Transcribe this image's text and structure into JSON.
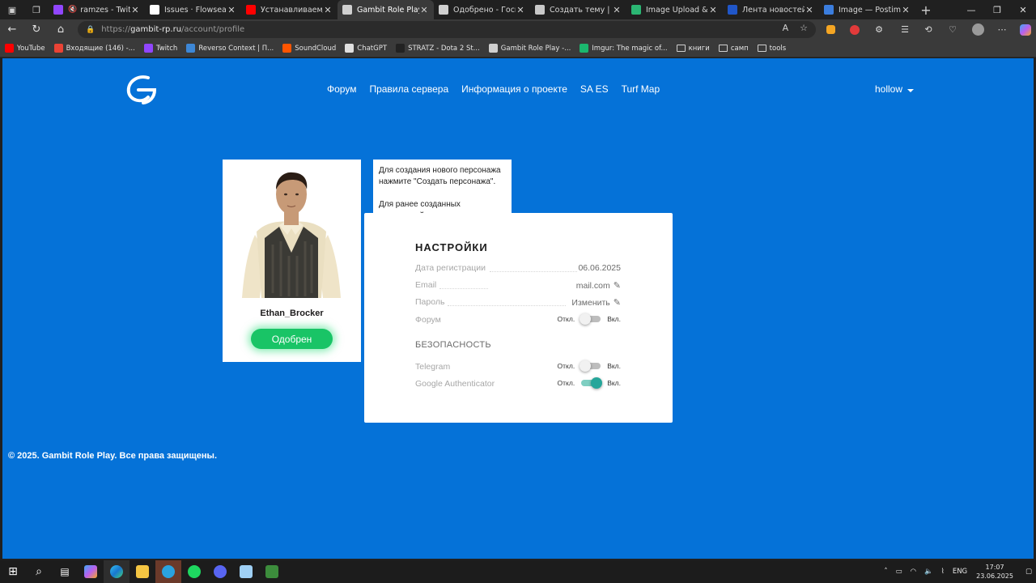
{
  "browser": {
    "tabs": [
      {
        "title": "ramzes - Twitch",
        "color": "#9146ff",
        "muted": true
      },
      {
        "title": "Issues · Flowseal/zapr",
        "color": "#ffffff"
      },
      {
        "title": "Устанавливаем/чини",
        "color": "#ff0000"
      },
      {
        "title": "Gambit Role Play - Пр",
        "color": "#d0d0d0",
        "active": true
      },
      {
        "title": "Одобрено - Госпита",
        "color": "#d0d0d0"
      },
      {
        "title": "Создать тему | San A",
        "color": "#c8c8c8"
      },
      {
        "title": "Image Upload & Mem",
        "color": "#2bb673"
      },
      {
        "title": "Лента новостей",
        "color": "#2056c8"
      },
      {
        "title": "Image — Postimages",
        "color": "#3b7ddd"
      }
    ],
    "url_prefix": "https://",
    "url_host": "gambit-rp.ru",
    "url_path": "/account/profile",
    "bookmarks": [
      {
        "label": "YouTube",
        "color": "#ff0000"
      },
      {
        "label": "Входящие (146) -...",
        "color": "#ea4335"
      },
      {
        "label": "Twitch",
        "color": "#9146ff"
      },
      {
        "label": "Reverso Context | П...",
        "color": "#3d87d6"
      },
      {
        "label": "SoundCloud",
        "color": "#ff5500"
      },
      {
        "label": "ChatGPT",
        "color": "#e0e0e0"
      },
      {
        "label": "STRATZ - Dota 2 St...",
        "color": "#222222"
      },
      {
        "label": "Gambit Role Play -...",
        "color": "#d0d0d0"
      },
      {
        "label": "Imgur: The magic of...",
        "color": "#1bb76e"
      },
      {
        "label": "книги",
        "folder": true
      },
      {
        "label": "самп",
        "folder": true
      },
      {
        "label": "tools",
        "folder": true
      }
    ]
  },
  "site": {
    "nav": [
      "Форум",
      "Правила сервера",
      "Информация о проекте",
      "SA ES",
      "Turf Map"
    ],
    "username": "hollow",
    "accent": "#0572d8"
  },
  "character": {
    "name": "Ethan_Brocker",
    "status": "Одобрен",
    "status_color": "#19c466"
  },
  "tooltip": {
    "line1": "Для создания нового персонажа нажмите \"Создать персонажа\".",
    "line2": "Для ранее созданных персонажей"
  },
  "settings": {
    "title": "НАСТРОЙКИ",
    "rows": [
      {
        "label": "Дата регистрации",
        "value": "06.06.2025"
      },
      {
        "label": "Email",
        "value": "mail.com"
      },
      {
        "label": "Пароль",
        "value": "Изменить"
      },
      {
        "label": "Форум",
        "off": "Откл.",
        "on": "Вкл.",
        "enabled": false
      }
    ],
    "security_title": "БЕЗОПАСНОСТЬ",
    "security": [
      {
        "label": "Telegram",
        "off": "Откл.",
        "on": "Вкл.",
        "enabled": false
      },
      {
        "label": "Google Authenticator",
        "off": "Откл.",
        "on": "Вкл.",
        "enabled": true
      }
    ]
  },
  "footer": "© 2025. Gambit Role Play. Все права защищены.",
  "taskbar": {
    "lang": "ENG",
    "time": "17:07",
    "date": "23.06.2025"
  }
}
